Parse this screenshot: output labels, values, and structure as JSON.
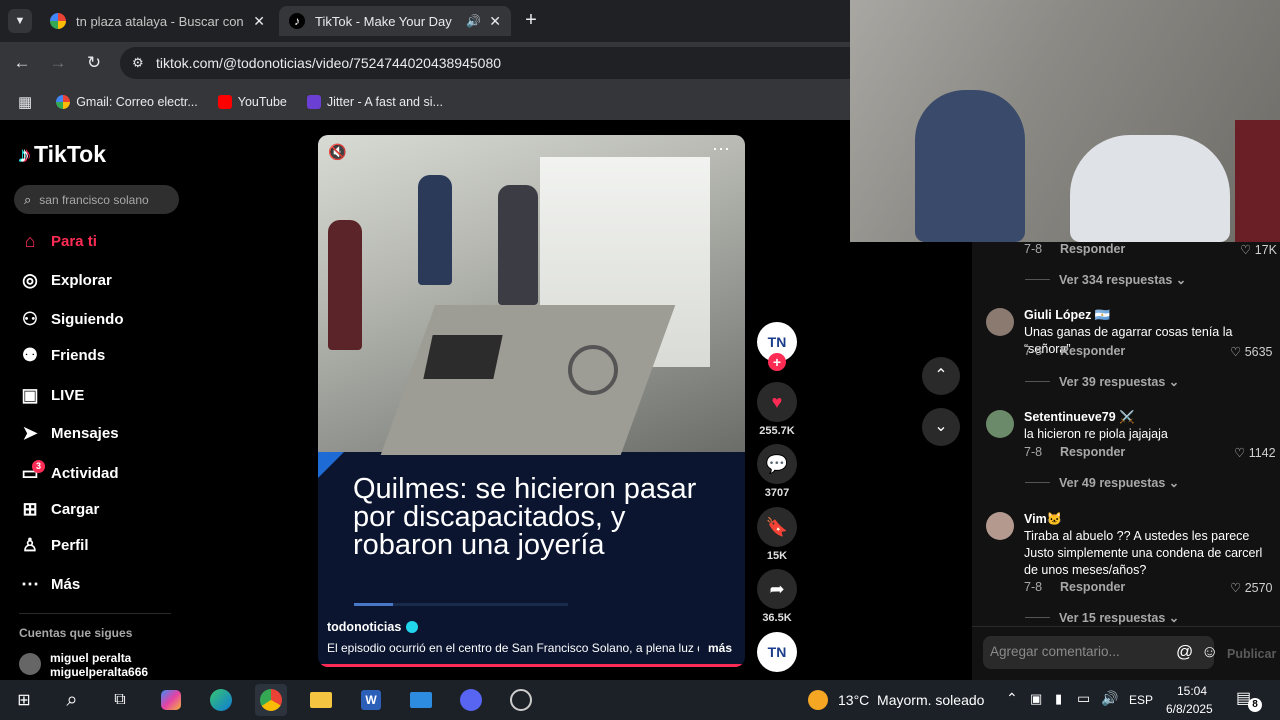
{
  "tabs": [
    {
      "title": "tn plaza atalaya - Buscar con Google",
      "active": false
    },
    {
      "title": "TikTok - Make Your Day",
      "active": true
    }
  ],
  "url": "tiktok.com/@todonoticias/video/7524744020438945080",
  "bookmarks": [
    {
      "label": "Gmail: Correo electr..."
    },
    {
      "label": "YouTube"
    },
    {
      "label": "Jitter - A fast and si..."
    }
  ],
  "tiktok": {
    "logo": "TikTok",
    "search_placeholder": "san francisco solano",
    "nav": [
      {
        "label": "Para ti",
        "icon": "home-icon"
      },
      {
        "label": "Explorar",
        "icon": "compass-icon"
      },
      {
        "label": "Siguiendo",
        "icon": "following-icon"
      },
      {
        "label": "Friends",
        "icon": "friends-icon"
      },
      {
        "label": "LIVE",
        "icon": "live-icon"
      },
      {
        "label": "Mensajes",
        "icon": "send-icon"
      },
      {
        "label": "Actividad",
        "icon": "inbox-icon",
        "badge": "3"
      },
      {
        "label": "Cargar",
        "icon": "upload-icon"
      },
      {
        "label": "Perfil",
        "icon": "profile-icon"
      },
      {
        "label": "Más",
        "icon": "more-icon"
      }
    ],
    "following_title": "Cuentas que sigues",
    "following_user": {
      "name": "miguel peralta",
      "handle": "miguelperalta666"
    },
    "video": {
      "headline": "Quilmes: se hicieron pasar por discapacitados, y robaron una joyería",
      "author": "todonoticias",
      "description": "El episodio ocurrió en el centro de San Francisco Solano, a plena luz del...",
      "more": "más",
      "progress": 0.18
    },
    "actions": {
      "likes": "255.7K",
      "comments": "3707",
      "saves": "15K",
      "shares": "36.5K"
    },
    "comments": {
      "top_meta": {
        "date": "7-8",
        "reply": "Responder",
        "likes": "17K",
        "replies": "Ver 334 respuestas"
      },
      "items": [
        {
          "name": "Giuli López 🇦🇷",
          "text": "Unas ganas de agarrar cosas tenía la “señora”",
          "date": "7-8",
          "reply": "Responder",
          "likes": "5635",
          "replies": "Ver 39 respuestas"
        },
        {
          "name": "Setentinueve79 ⚔️",
          "text": "la hicieron re piola jajajaja",
          "date": "7-8",
          "reply": "Responder",
          "likes": "1142",
          "replies": "Ver 49 respuestas"
        },
        {
          "name": "Vim🐱",
          "text": "Tiraba al abuelo ?? A ustedes les parece Justo simplemente una condena de carcerl de unos meses/años?",
          "date": "7-8",
          "reply": "Responder",
          "likes": "2570",
          "replies": "Ver 15 respuestas"
        }
      ],
      "input_placeholder": "Agregar comentario...",
      "publish": "Publicar"
    }
  },
  "taskbar": {
    "weather": "13°C  Mayorm. soleado",
    "lang": "ESP",
    "time": "15:04",
    "date": "6/8/2025",
    "notifications": "8"
  }
}
